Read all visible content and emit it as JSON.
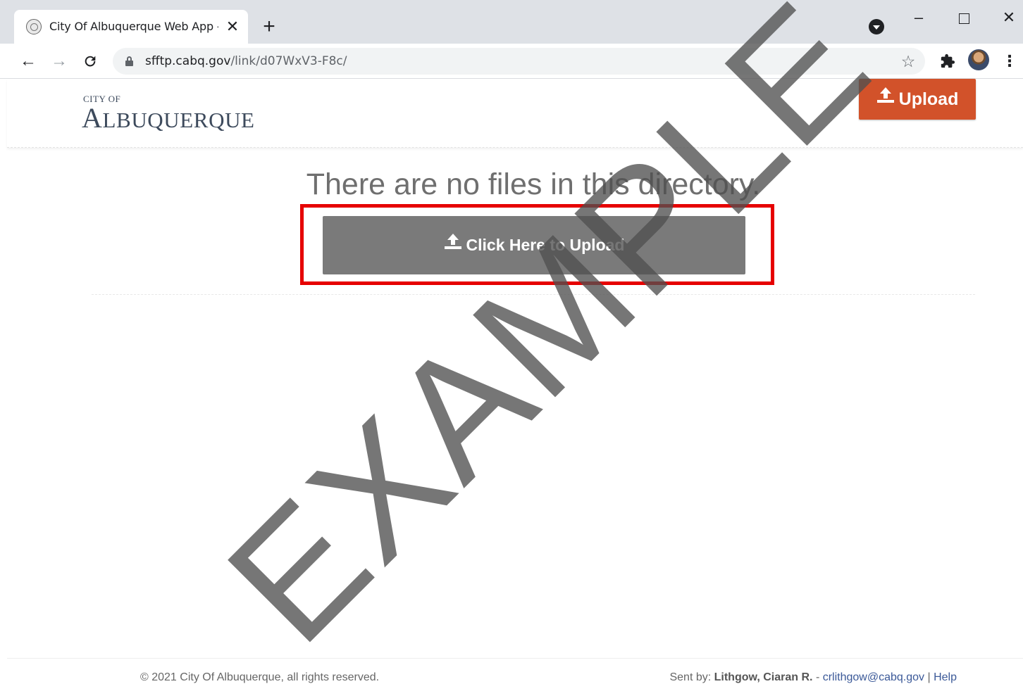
{
  "browser": {
    "tab_title": "City Of Albuquerque Web App - Link",
    "tab_close": "✕",
    "new_tab": "+",
    "url_host": "sfftp.cabq.gov",
    "url_path": "/link/d07WxV3-F8c/",
    "window_min": "–",
    "window_close": "✕",
    "back": "←",
    "forward": "→",
    "reload": "C",
    "star": "☆",
    "menu": "⋮"
  },
  "header": {
    "logo_small": "CITY OF",
    "logo_cap": "A",
    "logo_rest": "LBUQUERQUE",
    "upload_label": "Upload",
    "accent_color": "#d2522a"
  },
  "main": {
    "empty_message": "There are no files in this directory.",
    "upload_button_label": "Click Here to Upload",
    "button_color": "#7a7a7a",
    "highlight_color": "#e60000"
  },
  "watermark": {
    "text": "EXAMPLE"
  },
  "footer": {
    "copyright": "© 2021 City Of Albuquerque, all rights reserved.",
    "sent_by_prefix": "Sent by:",
    "sender_name": "Lithgow, Ciaran R.",
    "separator": "-",
    "sender_email": "crlithgow@cabq.gov",
    "pipe": "|",
    "help_label": "Help"
  },
  "icons": {
    "favicon": "city-seal-icon",
    "lock": "lock-icon",
    "extensions": "puzzle-icon",
    "upload": "upload-icon"
  }
}
